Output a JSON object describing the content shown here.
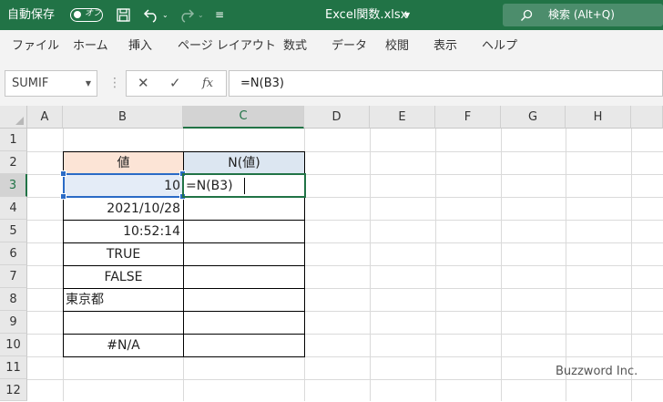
{
  "titlebar": {
    "autosave_label": "自動保存",
    "autosave_state": "オフ",
    "filename": "Excel関数.xlsx",
    "search_label": "検索 (Alt+Q)",
    "brand_color": "#217346"
  },
  "menu": [
    "ファイル",
    "ホーム",
    "挿入",
    "ページ レイアウト",
    "数式",
    "データ",
    "校閲",
    "表示",
    "ヘルプ"
  ],
  "formula_bar": {
    "name_box": "SUMIF",
    "formula": "=N(B3)",
    "fx_label": "fx"
  },
  "columns": [
    "A",
    "B",
    "C",
    "D",
    "E",
    "F",
    "G",
    "H"
  ],
  "rows": [
    "1",
    "2",
    "3",
    "4",
    "5",
    "6",
    "7",
    "8",
    "9",
    "10",
    "11",
    "12"
  ],
  "cells": {
    "B2": "値",
    "C2": "N(値)",
    "B3": "10",
    "C3": "=N(B3)",
    "B4": "2021/10/28",
    "B5": "10:52:14",
    "B6": "TRUE",
    "B7": "FALSE",
    "B8": "東京都",
    "B9": "",
    "B10": "#N/A"
  },
  "watermark": "Buzzword Inc."
}
